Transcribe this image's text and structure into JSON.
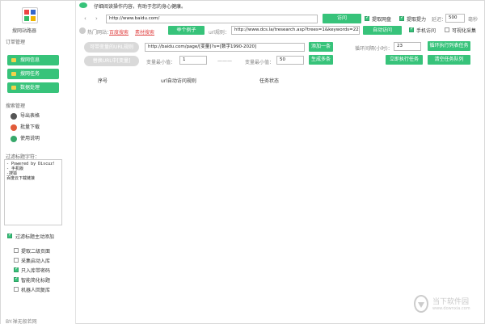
{
  "notice": "仔细阅读操作内容，有助于您的身心健康。",
  "app_name": "搜网站路器",
  "sidebar": {
    "section_order": "订单管理",
    "nav": [
      {
        "label": "搜网信息"
      },
      {
        "label": "搜网任务"
      },
      {
        "label": "数据处理"
      }
    ],
    "section_tools": "搜索管理",
    "tools": [
      {
        "label": "导出表格"
      },
      {
        "label": "批量下载"
      },
      {
        "label": "使用说明"
      }
    ],
    "section_filter": "过滤标题字符：",
    "filter_text": "- Powered by Discuz!\n- 手机版\n-搜狐\n百度云下载链接",
    "auto_filter_label": "过滤标题主动添加",
    "options": [
      {
        "label": "提取二级页面",
        "checked": false
      },
      {
        "label": "采集启动入库",
        "checked": false
      },
      {
        "label": "只入库带密码",
        "checked": true
      },
      {
        "label": "智能简化标题",
        "checked": true
      },
      {
        "label": "机器人回复库",
        "checked": false
      }
    ],
    "footer": "BY:禅无般若网"
  },
  "toolbar": {
    "url": "http://www.baidu.com/",
    "visit_label": "访问",
    "extract_netdisk": "提取网盘",
    "extract_code": "提取提力",
    "interval_label": "延迟：",
    "interval_value": "500",
    "interval_unit": "毫秒",
    "hot_label": "热门网站：",
    "hot_links": [
      "百度搜索",
      "素材搜索"
    ],
    "example_label": "举个例子",
    "url_rule_label": "url规则：",
    "url_rule_value": "http://www.dcs.la/tresearch.asp?trees=1&keywords=22&page=2",
    "auto_visit_label": "自动访问",
    "mobile_visit": "手机访问",
    "visual_collect": "可视化采集"
  },
  "config": {
    "page_url_btn": "可带变量的URL规则",
    "page_url_value": "http://baidu.com/page/[变量]?s=[数字1990-2020]",
    "add_one": "添加一条",
    "replace_btn": "替换URL中[变量]",
    "min_label": "变量最小值：",
    "min_value": "1",
    "dash": "———",
    "max_label": "变量最小值：",
    "max_value": "50",
    "generate_more": "生成多条",
    "loop_label": "循环间隔(小时)：",
    "loop_value": "23",
    "loop_btn": "循环执行列表任务",
    "run_now": "立即执行任务",
    "clear_queue": "清空任务队列"
  },
  "table": {
    "headers": [
      "序号",
      "url自动访问规则",
      "任务状态"
    ]
  },
  "watermark": {
    "brand": "当下软件园",
    "site": "www.downxia.com"
  },
  "colors": {
    "accent": "#37c37a",
    "link": "#e14a4a",
    "disabled": "#d9d9d9"
  }
}
